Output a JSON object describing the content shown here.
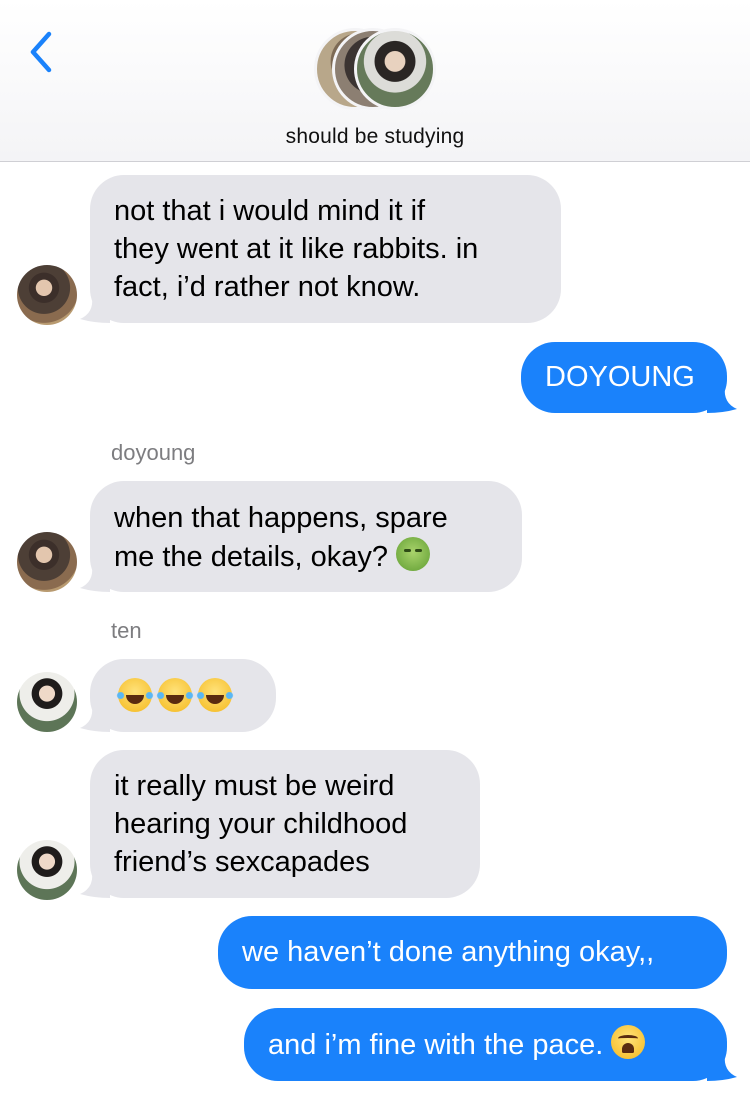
{
  "header": {
    "chat_title": "should be studying",
    "back_icon": "chevron-left-icon",
    "accent_color": "#1a82fb"
  },
  "messages": [
    {
      "lines": [
        "not that i would mind it if",
        "they went at it like rabbits. in",
        "fact, i’d rather not know."
      ]
    },
    {
      "lines": [
        "DOYOUNG"
      ]
    },
    {
      "sender": "doyoung",
      "lines": [
        "when that happens, spare",
        "me the details, okay?"
      ],
      "emoji": "nauseated-face-emoji"
    },
    {
      "sender": "ten",
      "emoji": "tears-of-joy-emoji",
      "emoji_count": 3
    },
    {
      "lines": [
        "it really must be weird",
        "hearing your childhood",
        "friend’s sexcapades"
      ]
    },
    {
      "lines": [
        "we haven’t done anything okay,,"
      ]
    },
    {
      "lines": [
        "and i’m fine with the pace."
      ],
      "emoji": "weary-face-emoji"
    }
  ],
  "colors": {
    "incoming_bubble": "#e5e5ea",
    "outgoing_bubble": "#1a82fb"
  }
}
